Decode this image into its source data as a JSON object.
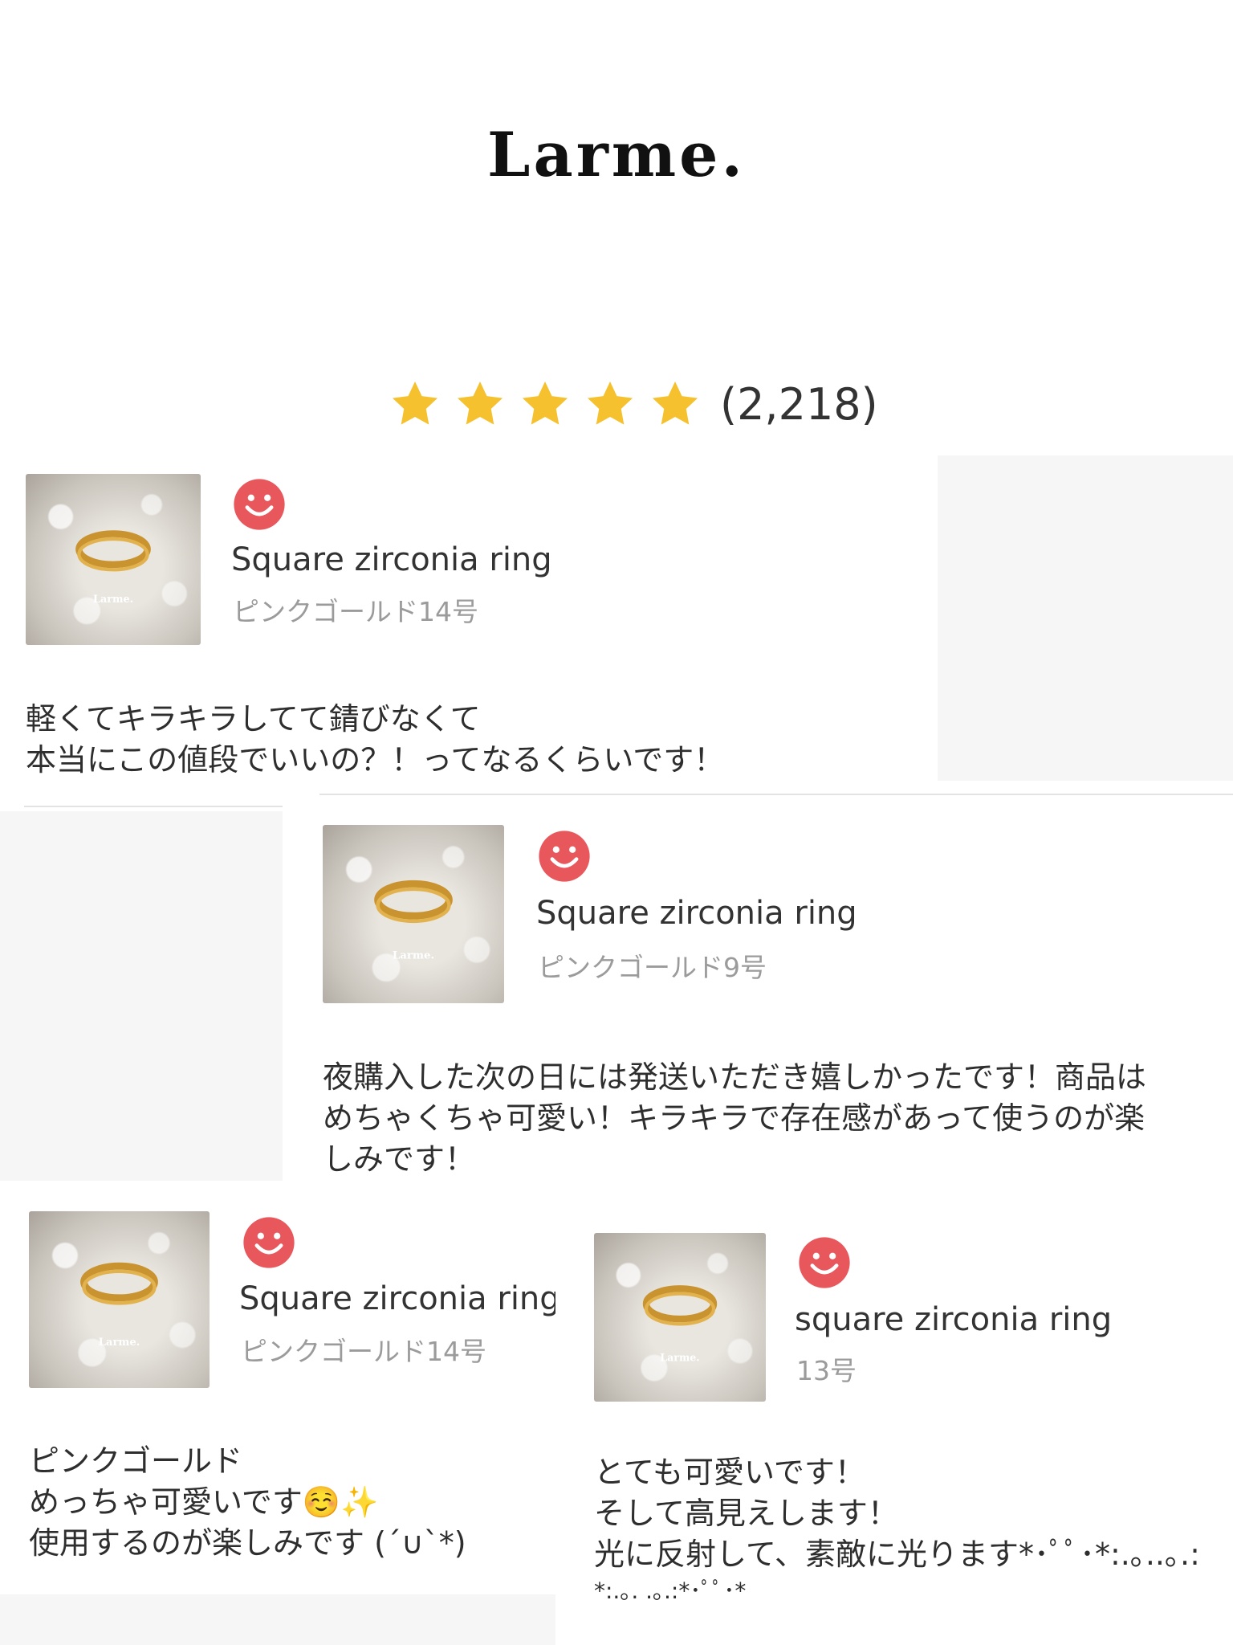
{
  "brand": {
    "logo_text": "Larme."
  },
  "rating": {
    "stars": 5,
    "count": "(2,218)",
    "star_color": "#f5c12e"
  },
  "accent": {
    "smile_color": "#e8575c"
  },
  "reviews": [
    {
      "title": "Square zirconia ring",
      "variant": "ピンクゴールド14号",
      "body": [
        "軽くてキラキラしてて錆びなくて",
        "本当にこの値段でいいの？！ってなるくらいです！"
      ],
      "thumb_caption": "Larme."
    },
    {
      "title": "Square zirconia ring",
      "variant": "ピンクゴールド9号",
      "body": [
        "夜購入した次の日には発送いただき嬉しかったです！商品は",
        "めちゃくちゃ可愛い！キラキラで存在感があって使うのが楽",
        "しみです！"
      ],
      "thumb_caption": "Larme."
    },
    {
      "title": "Square zirconia ring",
      "variant": "ピンクゴールド14号",
      "body": [
        "ピンクゴールド",
        "めっちゃ可愛いです☺️✨",
        "使用するのが楽しみです (´∪`*)"
      ],
      "thumb_caption": "Larme."
    },
    {
      "title": "square zirconia ring",
      "variant": "13号",
      "body": [
        "とても可愛いです！",
        "そして高見えします！",
        "光に反射して、素敵に光ります*･ﾟﾟ･*:.｡..｡.:",
        "*:.｡. .｡.:*･ﾟﾟ･*"
      ],
      "thumb_caption": "Larme."
    }
  ]
}
